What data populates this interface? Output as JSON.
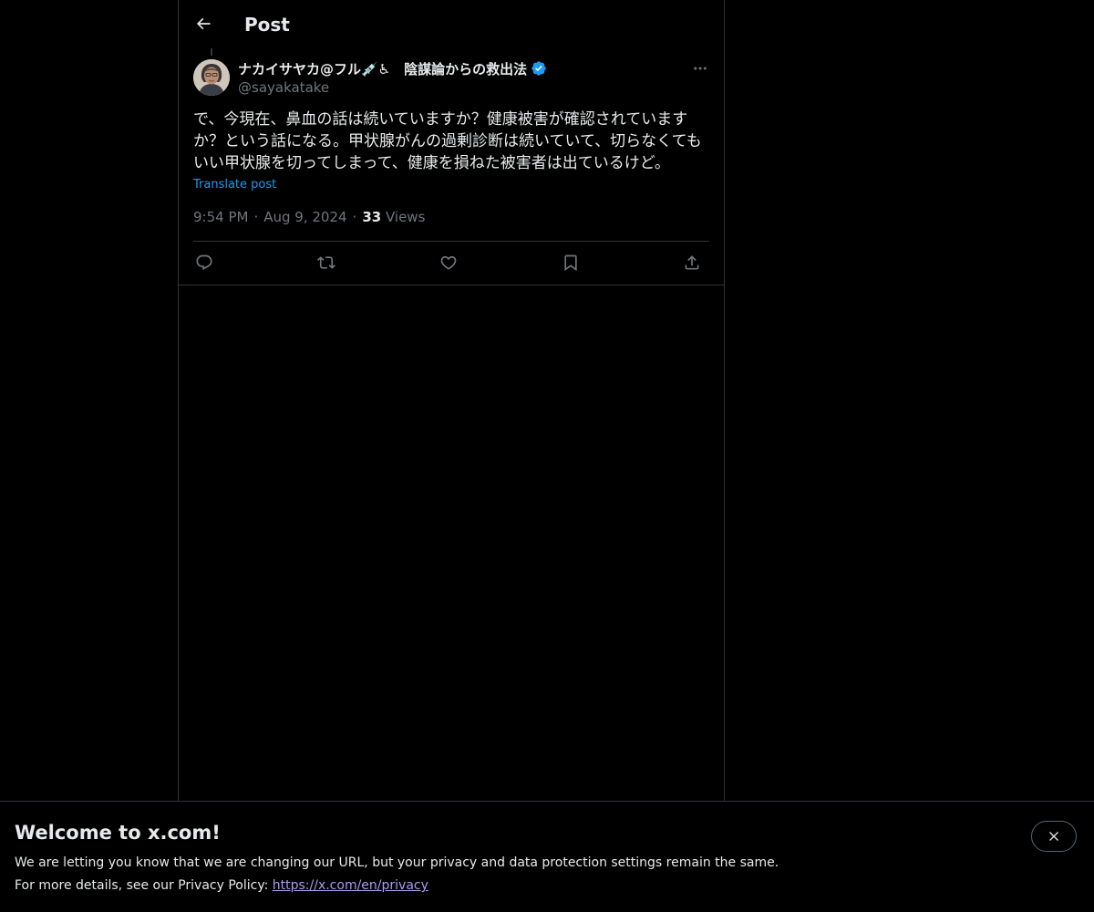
{
  "header": {
    "title": "Post"
  },
  "post": {
    "display_name": "ナカイサヤカ@フル💉♿　陰謀論からの救出法",
    "handle": "@sayakatake",
    "text": "で、今現在、鼻血の話は続いていますか？健康被害が確認されていますか？という話になる。甲状腺がんの過剰診断は続いていて、切らなくてもいい甲状腺を切ってしまって、健康を損ねた被害者は出ているけど。",
    "translate_label": "Translate post",
    "time": "9:54 PM",
    "date": "Aug 9, 2024",
    "views_count": "33",
    "views_label": "Views",
    "separator": "·"
  },
  "icons": {
    "back": "arrow-left-icon",
    "verified": "verified-badge-icon",
    "more": "more-horizontal-icon",
    "reply": "reply-icon",
    "repost": "repost-icon",
    "like": "heart-icon",
    "bookmark": "bookmark-icon",
    "share": "share-icon",
    "close": "close-icon"
  },
  "banner": {
    "title": "Welcome to x.com!",
    "line1": "We are letting you know that we are changing our URL, but your privacy and data protection settings remain the same.",
    "line2_prefix": "For more details, see our Privacy Policy: ",
    "link": "https://x.com/en/privacy"
  },
  "colors": {
    "background": "#000000",
    "text": "#e7e9ea",
    "muted": "#71767b",
    "accent": "#1d9bf0",
    "border": "#2f3336",
    "link_visited": "#a99bf0"
  }
}
